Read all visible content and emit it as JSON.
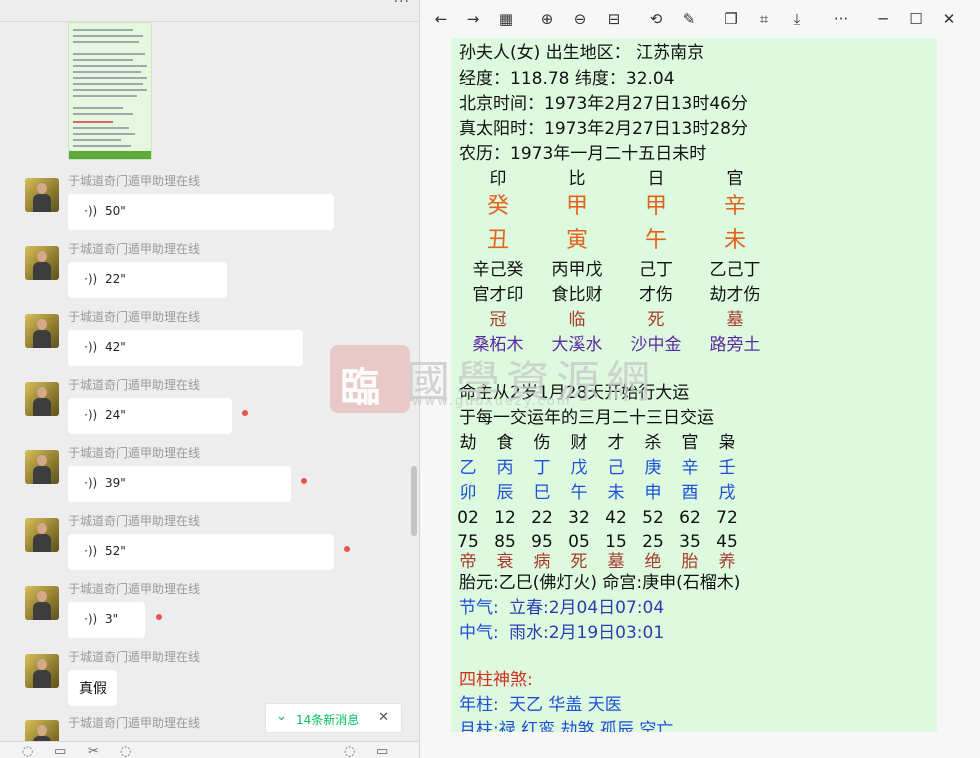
{
  "chat": {
    "sender_name": "于城道奇门遁甲助理在线",
    "messages": [
      {
        "type": "voice",
        "duration": "50\"",
        "unread": false
      },
      {
        "type": "voice",
        "duration": "22\"",
        "unread": false
      },
      {
        "type": "voice",
        "duration": "42\"",
        "unread": false
      },
      {
        "type": "voice",
        "duration": "24\"",
        "unread": true
      },
      {
        "type": "voice",
        "duration": "39\"",
        "unread": true
      },
      {
        "type": "voice",
        "duration": "52\"",
        "unread": true
      },
      {
        "type": "voice",
        "duration": "3\"",
        "unread": true
      },
      {
        "type": "text",
        "text": "真假",
        "unread": false
      },
      {
        "type": "partial",
        "unread": false
      }
    ],
    "voice_icon": "voice-wave-icon",
    "new_messages": "14条新消息",
    "colors": {
      "accent": "#07c160",
      "unread_dot": "#e8554e",
      "background": "#ededed"
    }
  },
  "viewer": {
    "toolbar_icons": [
      "back-arrow-icon",
      "forward-arrow-icon",
      "grid-icon",
      "zoom-in-icon",
      "zoom-out-icon",
      "fit-width-icon",
      "rotate-icon",
      "edit-icon",
      "copy-icon",
      "crop-icon",
      "download-icon",
      "more-icon",
      "minimize-icon",
      "maximize-icon",
      "close-icon"
    ],
    "doc_background": "#ddfadf",
    "lines": {
      "l1": "孙夫人(女) 出生地区：  江苏南京",
      "l2": "经度：118.78 纬度：32.04",
      "l3": "北京时间：1973年2月27日13时46分",
      "l4": "真太阳时：1973年2月27日13时28分",
      "l5": "农历：1973年一月二十五日未时"
    },
    "pillars": {
      "ten_gods": [
        "印",
        "比",
        "日",
        "官"
      ],
      "stems": [
        "癸",
        "甲",
        "甲",
        "辛"
      ],
      "branches": [
        "丑",
        "寅",
        "午",
        "未"
      ],
      "hidden_stems": [
        "辛己癸",
        "丙甲戊",
        "己丁",
        "乙己丁"
      ],
      "hidden_gods": [
        "官才印",
        "食比财",
        "才伤",
        "劫才伤"
      ],
      "life_stage": [
        "冠",
        "临",
        "死",
        "墓"
      ],
      "nayin": [
        "桑柘木",
        "大溪水",
        "沙中金",
        "路旁土"
      ]
    },
    "luck": {
      "start": "命主从2岁1月28天开始行大运",
      "change": "于每一交运年的三月二十三日交运",
      "gods": [
        "劫",
        "食",
        "伤",
        "财",
        "才",
        "杀",
        "官",
        "枭"
      ],
      "stems": [
        "乙",
        "丙",
        "丁",
        "戊",
        "己",
        "庚",
        "辛",
        "壬"
      ],
      "branches": [
        "卯",
        "辰",
        "巳",
        "午",
        "未",
        "申",
        "酉",
        "戌"
      ],
      "ages": [
        "02",
        "12",
        "22",
        "32",
        "42",
        "52",
        "62",
        "72"
      ],
      "years": [
        "75",
        "85",
        "95",
        "05",
        "15",
        "25",
        "35",
        "45"
      ],
      "stages": [
        "帝",
        "衰",
        "病",
        "死",
        "墓",
        "绝",
        "胎",
        "养"
      ]
    },
    "extra": {
      "taiyuan": "胎元:乙巳(佛灯火) 命宫:庚申(石榴木)",
      "jieqi_label": "节气:",
      "jieqi_value": "立春:2月04日07:04",
      "zhongqi_label": "中气:",
      "zhongqi_value": "雨水:2月19日03:01",
      "shensha_title": "四柱神煞:",
      "year_label": "年柱:",
      "year_value": "天乙 华盖 天医",
      "month_partial": "月柱:禄 红鸾 劫煞 孤辰 空亡"
    },
    "watermark": {
      "text": "國學資源網",
      "seal": "臨",
      "url": "www.guoxuezy.com"
    }
  }
}
